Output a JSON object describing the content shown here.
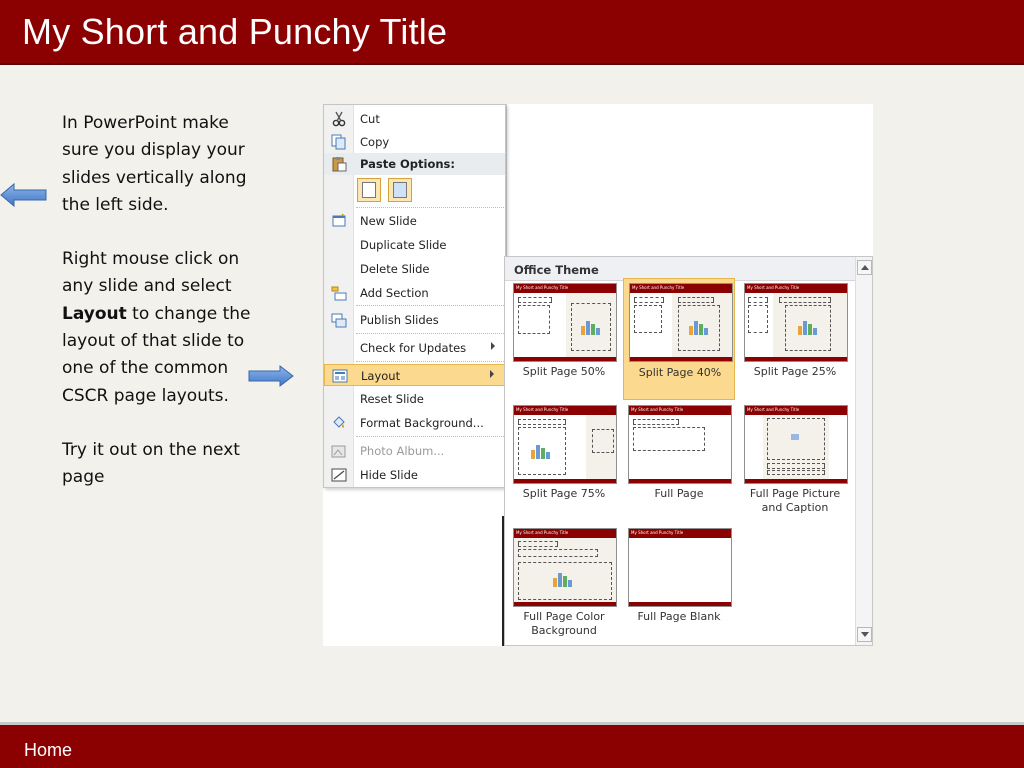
{
  "slide": {
    "title": "My Short and Punchy Title",
    "footer_link": "Home"
  },
  "instructions": {
    "para1": "In PowerPoint make sure you display your slides vertically along the left side.",
    "para2_pre": "Right mouse click on any slide and select ",
    "para2_bold": "Layout",
    "para2_post": " to change the layout of that slide to one of the common CSCR page layouts.",
    "para3": "Try it out on the next page"
  },
  "context_menu": {
    "items": [
      {
        "label": "Cut",
        "icon": "scissors-icon"
      },
      {
        "label": "Copy",
        "icon": "copy-icon"
      },
      {
        "label": "Paste Options:",
        "icon": "paste-icon"
      },
      {
        "label": "New Slide",
        "icon": "new-slide-icon"
      },
      {
        "label": "Duplicate Slide",
        "icon": ""
      },
      {
        "label": "Delete Slide",
        "icon": ""
      },
      {
        "label": "Add Section",
        "icon": "section-icon"
      },
      {
        "label": "Publish Slides",
        "icon": "publish-icon"
      },
      {
        "label": "Check for Updates",
        "icon": ""
      },
      {
        "label": "Layout",
        "icon": "layout-icon"
      },
      {
        "label": "Reset Slide",
        "icon": ""
      },
      {
        "label": "Format Background...",
        "icon": "paint-bucket-icon"
      },
      {
        "label": "Photo Album...",
        "icon": "photo-album-icon"
      },
      {
        "label": "Hide Slide",
        "icon": "hide-slide-icon"
      }
    ]
  },
  "layout_gallery": {
    "header": "Office Theme",
    "thumb_title": "My Short and Punchy Title",
    "layouts": [
      {
        "label": "Split Page 50%",
        "selected": false
      },
      {
        "label": "Split Page 40%",
        "selected": true
      },
      {
        "label": "Split Page 25%",
        "selected": false
      },
      {
        "label": "Split Page 75%",
        "selected": false
      },
      {
        "label": "Full Page",
        "selected": false
      },
      {
        "label": "Full Page Picture and Caption",
        "selected": false
      },
      {
        "label": "Full Page Color Background",
        "selected": false
      },
      {
        "label": "Full Page Blank",
        "selected": false
      }
    ]
  },
  "colors": {
    "brand_red": "#8b0000",
    "background": "#f3f1eb",
    "highlight": "#fbd98e",
    "arrow_blue": "#5b8fd6"
  }
}
